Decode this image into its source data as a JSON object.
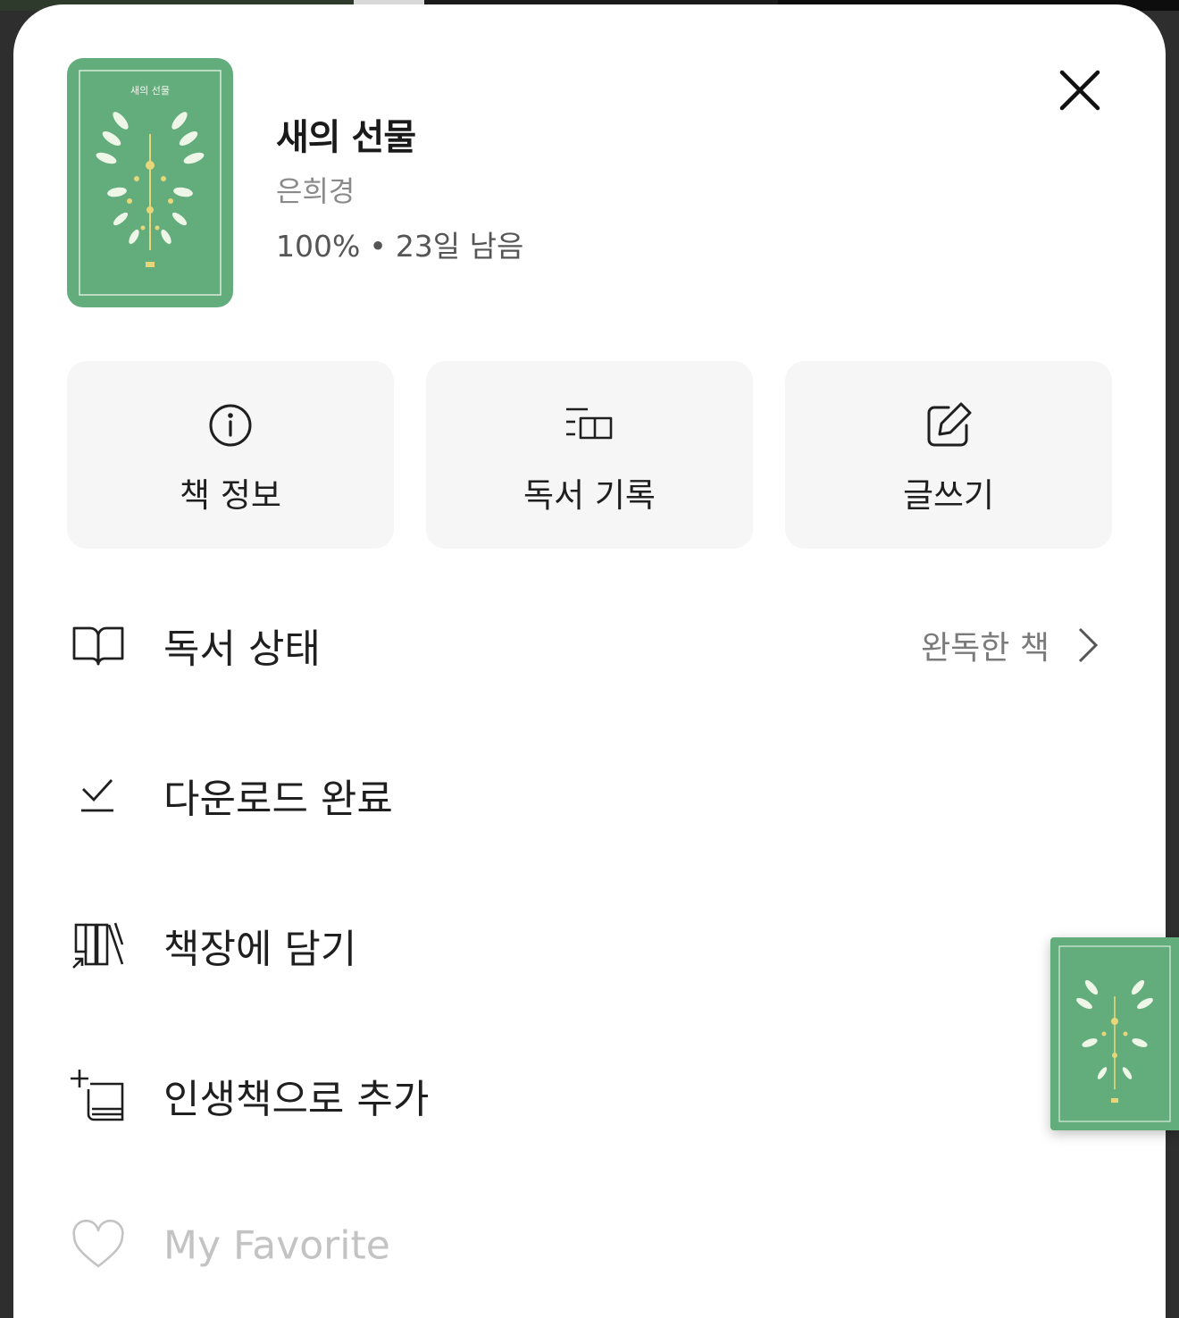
{
  "book": {
    "title": "새의 선물",
    "author": "은희경",
    "progress": "100%",
    "separator": "•",
    "remaining": "23일 남음",
    "cover_color": "#63ad7c",
    "cover_icon": "bird-wings-illustration"
  },
  "actions": [
    {
      "label": "책 정보",
      "icon": "info-icon"
    },
    {
      "label": "독서 기록",
      "icon": "reading-log-icon"
    },
    {
      "label": "글쓰기",
      "icon": "edit-icon"
    }
  ],
  "menu": {
    "reading_status": {
      "label": "독서 상태",
      "value": "완독한 책",
      "icon": "open-book-icon"
    },
    "download": {
      "label": "다운로드 완료",
      "icon": "download-check-icon"
    },
    "bookshelf": {
      "label": "책장에 담기",
      "icon": "bookshelf-icon"
    },
    "life_book": {
      "label": "인생책으로 추가",
      "icon": "add-book-icon"
    },
    "favorite": {
      "label": "My Favorite",
      "icon": "heart-icon"
    }
  },
  "colors": {
    "card_bg": "#f6f6f6",
    "text": "#1f1f1f",
    "muted": "#c3c3c3"
  }
}
